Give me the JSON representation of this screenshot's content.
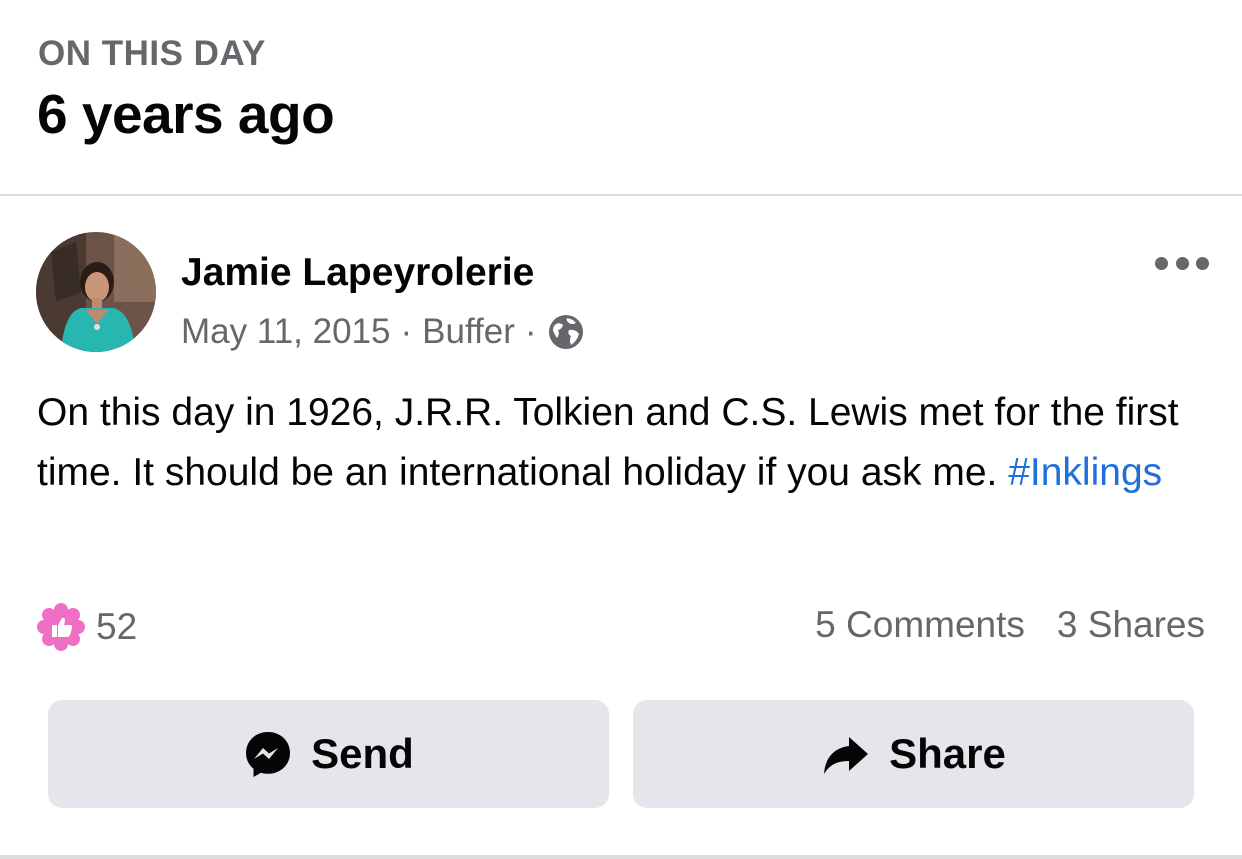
{
  "header": {
    "kicker": "ON THIS DAY",
    "headline": "6 years ago"
  },
  "post": {
    "author": "Jamie Lapeyrolerie",
    "date": "May 11, 2015",
    "source": "Buffer",
    "separator": "·",
    "privacy_icon": "globe-icon",
    "more_icon": "more-options-icon",
    "text": "On this day in 1926, J.R.R. Tolkien and C.S. Lewis met for the first time. It should be an international holiday if you ask me.",
    "hashtag": "#Inklings"
  },
  "engagement": {
    "reaction_icon": "like-pride-flower-icon",
    "reaction_count": "52",
    "comments": "5 Comments",
    "shares": "3 Shares"
  },
  "actions": {
    "send_label": "Send",
    "send_icon": "messenger-icon",
    "share_label": "Share",
    "share_icon": "share-arrow-icon"
  },
  "colors": {
    "text_primary": "#050505",
    "text_secondary": "#65676b",
    "link": "#216fdb",
    "button_bg": "#e4e6eb",
    "divider": "#dcdde0",
    "reaction_pink": "#ee6fc4"
  }
}
